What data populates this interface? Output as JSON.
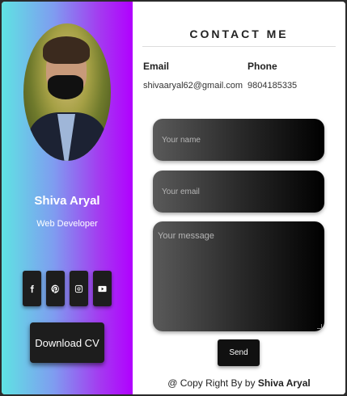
{
  "profile": {
    "name": "Shiva Aryal",
    "role": "Web Developer",
    "download_label": "Download CV"
  },
  "socials": [
    {
      "icon": "facebook-icon"
    },
    {
      "icon": "pinterest-icon"
    },
    {
      "icon": "instagram-icon"
    },
    {
      "icon": "youtube-icon"
    }
  ],
  "contact": {
    "title": "CONTACT ME",
    "email_label": "Email",
    "email_value": "shivaaryal62@gmail.com",
    "phone_label": "Phone",
    "phone_value": "9804185335"
  },
  "form": {
    "name_placeholder": "Your name",
    "email_placeholder": "Your email",
    "message_placeholder": "Your message",
    "send_label": "Send"
  },
  "footer": {
    "prefix": "@ Copy Right By by ",
    "author": "Shiva Aryal"
  }
}
